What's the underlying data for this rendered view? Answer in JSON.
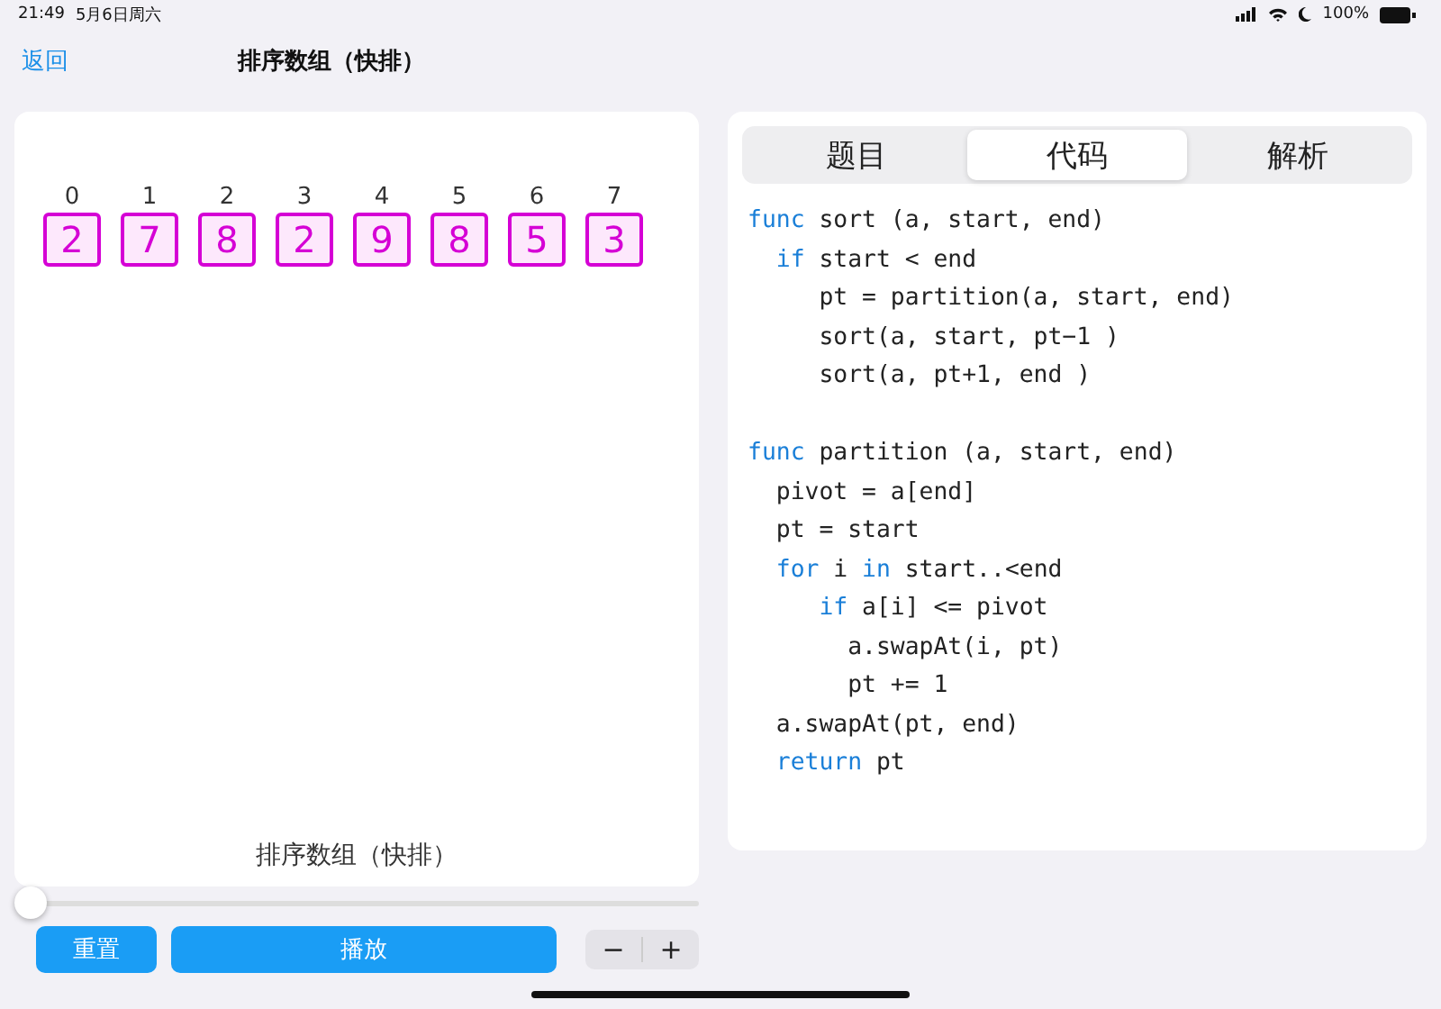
{
  "status_bar": {
    "time": "21:49",
    "date": "5月6日周六",
    "battery": "100%"
  },
  "nav": {
    "back": "返回",
    "title": "排序数组（快排）"
  },
  "array": [
    {
      "index": "0",
      "value": "2"
    },
    {
      "index": "1",
      "value": "7"
    },
    {
      "index": "2",
      "value": "8"
    },
    {
      "index": "3",
      "value": "2"
    },
    {
      "index": "4",
      "value": "9"
    },
    {
      "index": "5",
      "value": "8"
    },
    {
      "index": "6",
      "value": "5"
    },
    {
      "index": "7",
      "value": "3"
    }
  ],
  "caption": "排序数组（快排）",
  "slider": {
    "level": 0
  },
  "buttons": {
    "reset": "重置",
    "play": "播放",
    "minus": "−",
    "plus": "+"
  },
  "tabs": [
    {
      "label": "题目",
      "selected": false
    },
    {
      "label": "代码",
      "selected": true
    },
    {
      "label": "解析",
      "selected": false
    }
  ],
  "code": [
    {
      "kind": "code",
      "parts": [
        {
          "text": "func",
          "kind": "keyword"
        },
        {
          "text": " sort (a, start, end)",
          "kind": "plain"
        }
      ]
    },
    {
      "kind": "code",
      "parts": [
        {
          "text": "  if",
          "kind": "keyword"
        },
        {
          "text": " start < end",
          "kind": "plain"
        }
      ]
    },
    {
      "kind": "code",
      "parts": [
        {
          "text": "     pt = partition(a, start, end)",
          "kind": "plain"
        }
      ]
    },
    {
      "kind": "code",
      "parts": [
        {
          "text": "     sort(a, start, pt−1 )",
          "kind": "plain"
        }
      ]
    },
    {
      "kind": "code",
      "parts": [
        {
          "text": "     sort(a, pt+1, end )",
          "kind": "plain"
        }
      ]
    },
    {
      "kind": "blank"
    },
    {
      "kind": "code",
      "parts": [
        {
          "text": "func",
          "kind": "keyword"
        },
        {
          "text": " partition (a, start, end)",
          "kind": "plain"
        }
      ]
    },
    {
      "kind": "code",
      "parts": [
        {
          "text": "  pivot = a[end]",
          "kind": "plain"
        }
      ]
    },
    {
      "kind": "code",
      "parts": [
        {
          "text": "  pt = start",
          "kind": "plain"
        }
      ]
    },
    {
      "kind": "code",
      "parts": [
        {
          "text": "  for",
          "kind": "keyword"
        },
        {
          "text": " i ",
          "kind": "plain"
        },
        {
          "text": "in",
          "kind": "keyword"
        },
        {
          "text": " start..<end",
          "kind": "plain"
        }
      ]
    },
    {
      "kind": "code",
      "parts": [
        {
          "text": "     if",
          "kind": "keyword"
        },
        {
          "text": " a[i] <= pivot",
          "kind": "plain"
        }
      ]
    },
    {
      "kind": "code",
      "parts": [
        {
          "text": "       a.swapAt(i, pt)",
          "kind": "plain"
        }
      ]
    },
    {
      "kind": "code",
      "parts": [
        {
          "text": "       pt += 1",
          "kind": "plain"
        }
      ]
    },
    {
      "kind": "code",
      "parts": [
        {
          "text": "  a.swapAt(pt, end)",
          "kind": "plain"
        }
      ]
    },
    {
      "kind": "code",
      "parts": [
        {
          "text": "  return",
          "kind": "keyword"
        },
        {
          "text": " pt",
          "kind": "plain"
        }
      ]
    }
  ]
}
